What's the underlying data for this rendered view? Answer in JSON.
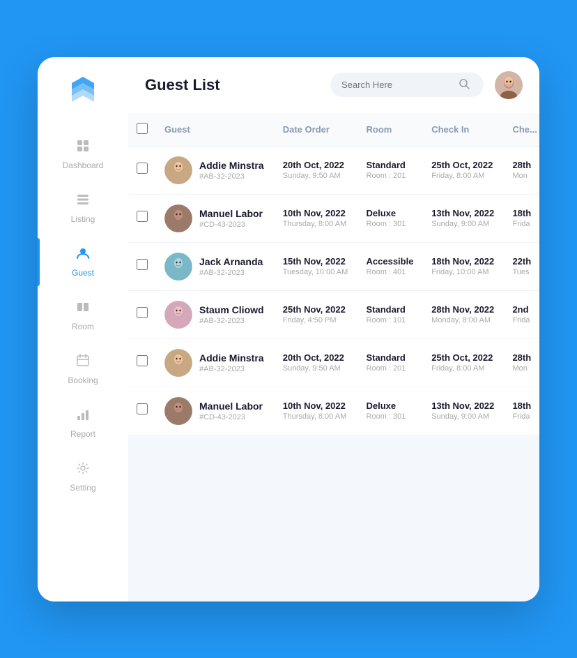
{
  "app": {
    "logo_alt": "App Logo"
  },
  "topbar": {
    "title": "Guest List",
    "search_placeholder": "Search Here"
  },
  "sidebar": {
    "items": [
      {
        "id": "dashboard",
        "label": "Dashboard",
        "icon": "⊞",
        "active": false
      },
      {
        "id": "listing",
        "label": "Listing",
        "icon": "☰",
        "active": false
      },
      {
        "id": "guest",
        "label": "Guest",
        "icon": "👤",
        "active": true
      },
      {
        "id": "room",
        "label": "Room",
        "icon": "⊟",
        "active": false
      },
      {
        "id": "booking",
        "label": "Booking",
        "icon": "📋",
        "active": false
      },
      {
        "id": "report",
        "label": "Report",
        "icon": "📊",
        "active": false
      },
      {
        "id": "setting",
        "label": "Setting",
        "icon": "⚙",
        "active": false
      }
    ]
  },
  "table": {
    "columns": [
      "Guest",
      "Date Order",
      "Room",
      "Check In",
      "Che..."
    ],
    "rows": [
      {
        "id": 1,
        "name": "Addie Minstra",
        "booking_id": "#AB-32-2023",
        "date_order_primary": "20th Oct, 2022",
        "date_order_secondary": "Sunday, 9:50 AM",
        "room_type": "Standard",
        "room_number": "Room : 201",
        "checkin_primary": "25th Oct, 2022",
        "checkin_secondary": "Friday, 8:00 AM",
        "checkout_primary": "28th",
        "checkout_secondary": "Mon"
      },
      {
        "id": 2,
        "name": "Manuel Labor",
        "booking_id": "#CD-43-2023",
        "date_order_primary": "10th Nov, 2022",
        "date_order_secondary": "Thursday, 8:00 AM",
        "room_type": "Deluxe",
        "room_number": "Room : 301",
        "checkin_primary": "13th Nov, 2022",
        "checkin_secondary": "Sunday, 9:00 AM",
        "checkout_primary": "18th",
        "checkout_secondary": "Frida"
      },
      {
        "id": 3,
        "name": "Jack Arnanda",
        "booking_id": "#AB-32-2023",
        "date_order_primary": "15th Nov, 2022",
        "date_order_secondary": "Tuesday, 10:00 AM",
        "room_type": "Accessible",
        "room_number": "Room : 401",
        "checkin_primary": "18th Nov, 2022",
        "checkin_secondary": "Friday, 10:00 AM",
        "checkout_primary": "22th",
        "checkout_secondary": "Tues"
      },
      {
        "id": 4,
        "name": "Staum Cliowd",
        "booking_id": "#AB-32-2023",
        "date_order_primary": "25th Nov, 2022",
        "date_order_secondary": "Friday, 4:50 PM",
        "room_type": "Standard",
        "room_number": "Room : 101",
        "checkin_primary": "28th Nov, 2022",
        "checkin_secondary": "Monday, 8:00 AM",
        "checkout_primary": "2nd",
        "checkout_secondary": "Frida"
      },
      {
        "id": 5,
        "name": "Addie Minstra",
        "booking_id": "#AB-32-2023",
        "date_order_primary": "20th Oct, 2022",
        "date_order_secondary": "Sunday, 9:50 AM",
        "room_type": "Standard",
        "room_number": "Room : 201",
        "checkin_primary": "25th Oct, 2022",
        "checkin_secondary": "Friday, 8:00 AM",
        "checkout_primary": "28th",
        "checkout_secondary": "Mon"
      },
      {
        "id": 6,
        "name": "Manuel Labor",
        "booking_id": "#CD-43-2023",
        "date_order_primary": "10th Nov, 2022",
        "date_order_secondary": "Thursday, 8:00 AM",
        "room_type": "Deluxe",
        "room_number": "Room : 301",
        "checkin_primary": "13th Nov, 2022",
        "checkin_secondary": "Sunday, 9:00 AM",
        "checkout_primary": "18th",
        "checkout_secondary": "Frida"
      }
    ]
  },
  "colors": {
    "primary": "#2196F3",
    "accent": "#1976D2",
    "background": "#2196F3",
    "sidebar_bg": "#ffffff",
    "text_dark": "#1a1a2e",
    "text_muted": "#aaaaaa"
  }
}
